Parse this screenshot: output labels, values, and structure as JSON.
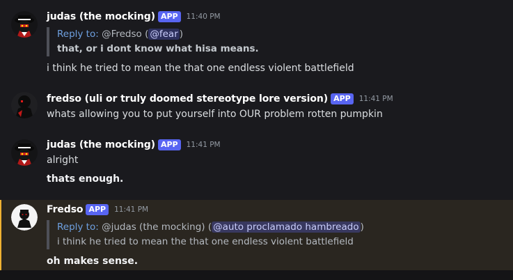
{
  "messages": [
    {
      "username": "judas (the mocking)",
      "badge": "APP",
      "time": "11:40 PM",
      "reply": {
        "prefix": "Reply to:",
        "target": "@Fredso",
        "mention": "@fear"
      },
      "quote": "that, or i dont know what hisa means.",
      "text": "i think he tried to mean the that one endless violent battlefield"
    },
    {
      "username": "fredso (uli or truly doomed stereotype lore version)",
      "badge": "APP",
      "time": "11:41 PM",
      "text": "whats allowing you to put yourself into OUR problem rotten pumpkin"
    },
    {
      "username": "judas (the mocking)",
      "badge": "APP",
      "time": "11:41 PM",
      "text": "alright",
      "text2": "thats enough."
    },
    {
      "username": "Fredso",
      "badge": "APP",
      "time": "11:41 PM",
      "reply": {
        "prefix": "Reply to:",
        "target": "@judas (the mocking)",
        "mention": "@auto proclamado hambreado"
      },
      "quote": "i think he tried to mean the that one endless violent battlefield",
      "text": "oh makes sense."
    }
  ],
  "colors": {
    "background": "#1a1a1e",
    "highlight_bg": "#2a2620",
    "highlight_border": "#f0b232",
    "badge": "#5865f2",
    "reply_link": "#6ea0e0"
  },
  "icons": {
    "avatar_judas": "masked-figure-with-hat-avatar",
    "avatar_fredso": "dark-figure-avatar",
    "avatar_fredso_white": "white-circle-figure-avatar"
  }
}
